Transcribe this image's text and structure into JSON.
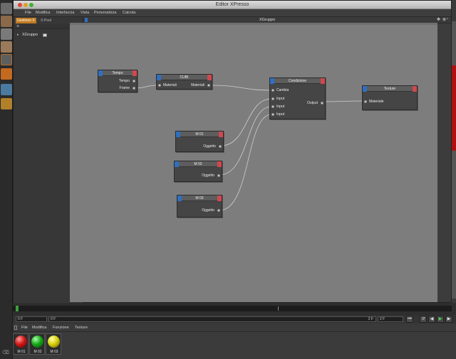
{
  "window": {
    "title": "Editor XPresso",
    "menu": [
      "File",
      "Modifica",
      "Interfaccia",
      "Vista",
      "Personalizza",
      "Calcola"
    ]
  },
  "left_panel": {
    "tabs": [
      "Gestione X",
      "X-Pool"
    ],
    "tree_item": "XGruppo"
  },
  "canvas": {
    "title": "XGruppo"
  },
  "nodes": {
    "tempo": {
      "title": "Tempo",
      "outputs": [
        "Tempo",
        "Frame"
      ]
    },
    "cubi": {
      "title": "CUBI",
      "input": "Materiali",
      "output": "Materiali"
    },
    "condizione": {
      "title": "Condizione",
      "inputs": [
        "Cambia",
        "Input",
        "Input",
        "Input"
      ],
      "output": "Output"
    },
    "texture": {
      "title": "Texture",
      "input": "Materiale"
    },
    "m01": {
      "title": "M 01",
      "output": "Oggetto"
    },
    "m02": {
      "title": "M 02",
      "output": "Oggetto"
    },
    "m03": {
      "title": "M 03",
      "output": "Oggetto"
    }
  },
  "timeline": {
    "current_frame": "0 F",
    "start_field": "0 F",
    "end_field": "2 F",
    "range_end": "2 F"
  },
  "material_manager": {
    "menu": [
      "File",
      "Modifica",
      "Funzione",
      "Texture"
    ],
    "materials": [
      {
        "name": "M 01",
        "color": "#d01818"
      },
      {
        "name": "M 02",
        "color": "#1aa81a"
      },
      {
        "name": "M 03",
        "color": "#d8d010"
      }
    ]
  },
  "colors": {
    "port_in": "#2f6fc0",
    "port_out": "#d0484e",
    "canvas_bg": "#7d7d7d"
  }
}
